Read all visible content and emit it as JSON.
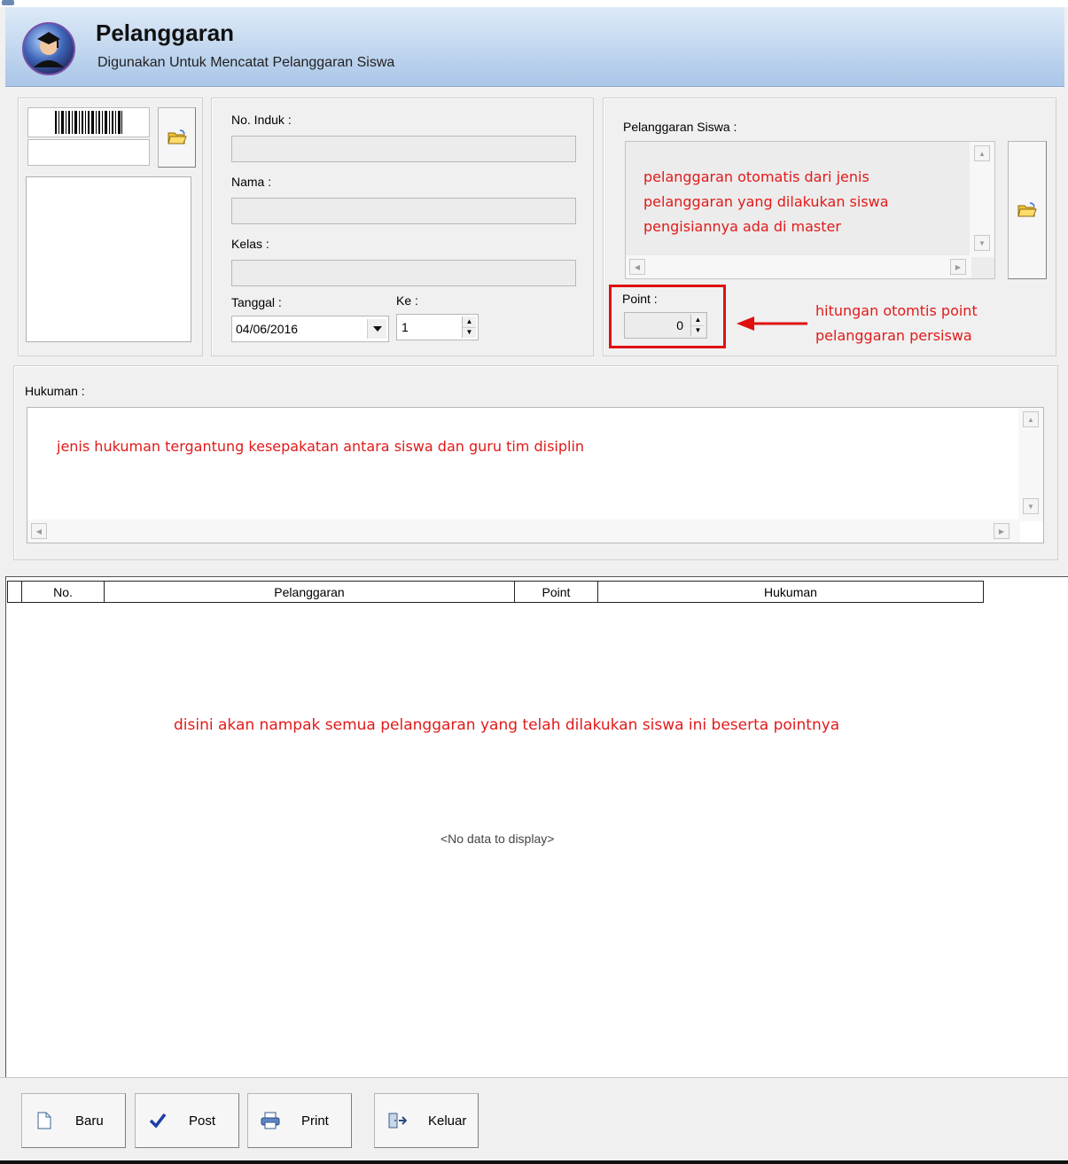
{
  "header": {
    "title": "Pelanggaran",
    "subtitle": "Digunakan Untuk Mencatat Pelanggaran Siswa"
  },
  "student": {
    "no_induk_label": "No. Induk :",
    "nama_label": "Nama :",
    "kelas_label": "Kelas :",
    "tanggal_label": "Tanggal :",
    "tanggal_value": "04/06/2016",
    "ke_label": "Ke :",
    "ke_value": "1"
  },
  "violation": {
    "label": "Pelanggaran Siswa :",
    "note_lines": [
      "pelanggaran otomatis dari jenis",
      "pelanggaran yang dilakukan siswa",
      "pengisiannya ada di master"
    ],
    "point_label": "Point :",
    "point_value": "0",
    "point_note_lines": [
      "hitungan otomtis point",
      "pelanggaran persiswa"
    ]
  },
  "hukuman": {
    "label": "Hukuman :",
    "note": "jenis hukuman tergantung kesepakatan antara siswa dan guru tim disiplin"
  },
  "grid": {
    "columns": [
      "No.",
      "Pelanggaran",
      "Point",
      "Hukuman"
    ],
    "note": "disini akan nampak semua pelanggaran yang telah dilakukan siswa ini beserta pointnya",
    "empty_text": "<No data to display>"
  },
  "footer": {
    "buttons": [
      {
        "label": "Baru",
        "icon": "new-document-icon"
      },
      {
        "label": "Post",
        "icon": "checkmark-icon"
      },
      {
        "label": "Print",
        "icon": "printer-icon"
      },
      {
        "label": "Keluar",
        "icon": "exit-door-icon"
      }
    ]
  },
  "colors": {
    "annotation_red": "#e11a1a",
    "header_gradient_top": "#ddeaf7",
    "header_gradient_bottom": "#aac6e8"
  }
}
